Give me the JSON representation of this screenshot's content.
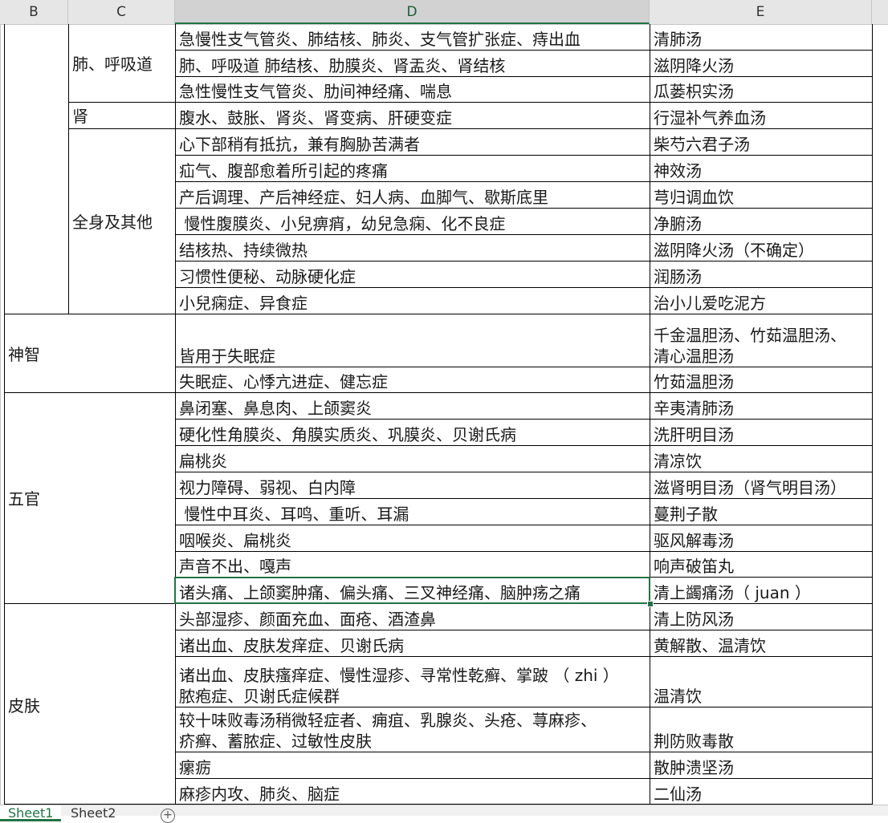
{
  "columns": {
    "B": "B",
    "C": "C",
    "D": "D",
    "E": "E"
  },
  "groups": {
    "lung": "肺、呼吸道",
    "kidney": "肾",
    "whole_body": "全身及其他",
    "mind": "神智",
    "facial": "五官",
    "skin": "皮肤"
  },
  "rows": [
    {
      "d": "急慢性支气管炎、肺结核、肺炎、支气管扩张症、痔出血",
      "e": "清肺汤"
    },
    {
      "d": "肺、呼吸道 肺结核、肋膜炎、肾盂炎、肾结核",
      "e": "滋阴降火汤"
    },
    {
      "d": "急性慢性支气管炎、肋间神经痛、喘息",
      "e": "瓜蒌枳实汤"
    },
    {
      "d": "腹水、鼓胀、肾炎、肾变病、肝硬变症",
      "e": "行湿补气养血汤"
    },
    {
      "d": "心下部稍有抵抗，兼有胸胁苦满者",
      "e": "柴芍六君子汤"
    },
    {
      "d": "疝气、腹部愈着所引起的疼痛",
      "e": "神效汤"
    },
    {
      "d": "产后调理、产后神经症、妇人病、血脚气、歇斯底里",
      "e": "芎归调血饮"
    },
    {
      "d": " 慢性腹膜炎、小兒痹痟，幼兒急痫、化不良症",
      "e": "净腑汤"
    },
    {
      "d": "结核热、持续微热",
      "e": "滋阴降火汤（不确定）"
    },
    {
      "d": "习惯性便秘、动脉硬化症",
      "e": "润肠汤"
    },
    {
      "d": "小兒痫症、异食症",
      "e": "治小儿爱吃泥方"
    },
    {
      "d": "皆用于失眠症",
      "e": "千金温胆汤、竹茹温胆汤、\n清心温胆汤"
    },
    {
      "d": "失眠症、心悸亢进症、健忘症",
      "e": "竹茹温胆汤"
    },
    {
      "d": "鼻闭塞、鼻息肉、上颌窦炎",
      "e": "辛夷清肺汤"
    },
    {
      "d": "硬化性角膜炎、角膜实质炎、巩膜炎、贝谢氏病",
      "e": "洗肝明目汤"
    },
    {
      "d": "扁桃炎",
      "e": "清凉饮"
    },
    {
      "d": "视力障碍、弱视、白内障",
      "e": "滋肾明目汤（肾气明目汤）"
    },
    {
      "d": " 慢性中耳炎、耳鸣、重听、耳漏",
      "e": "蔓荆子散"
    },
    {
      "d": "咽喉炎、扁桃炎",
      "e": "驱风解毒汤"
    },
    {
      "d": "声音不出、嘎声",
      "e": "响声破笛丸"
    },
    {
      "d": "诸头痛、上颌窦肿痛、偏头痛、三叉神经痛、脑肿疡之痛",
      "e": "清上蠲痛汤（ juan ）"
    },
    {
      "d": "头部湿疹、颜面充血、面疮、酒渣鼻",
      "e": "清上防风汤"
    },
    {
      "d": "诸出血、皮肤发痒症、贝谢氏病",
      "e": "黄解散、温清饮"
    },
    {
      "d": "诸出血、皮肤瘙痒症、慢性湿疹、寻常性乾癣、掌跛 （ zhi ）\n脓疱症、贝谢氏症候群",
      "e": "温清饮"
    },
    {
      "d": "较十味败毒汤稍微轻症者、痈疽、乳腺炎、头疮、荨麻疹、\n疥癣、蓄脓症、过敏性皮肤",
      "e": "荆防败毒散"
    },
    {
      "d": "瘰疬",
      "e": "散肿溃坚汤"
    },
    {
      "d": "麻疹内攻、肺炎、脑症",
      "e": "二仙汤"
    }
  ],
  "sheets": [
    "Sheet1",
    "Sheet2"
  ],
  "add_sheet_symbol": "+",
  "colors": {
    "accent": "#217346",
    "grid": "#000000",
    "header": "#e6e6e6"
  }
}
